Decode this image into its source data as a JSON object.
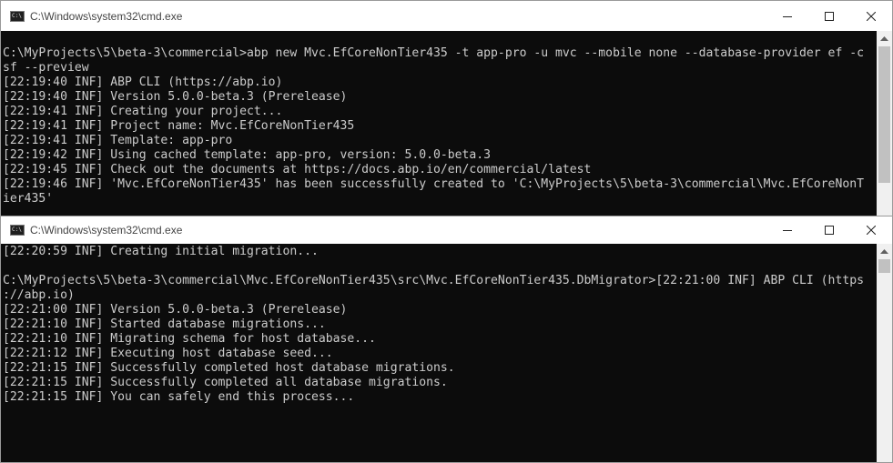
{
  "window_top": {
    "title": "C:\\Windows\\system32\\cmd.exe",
    "lines": [
      "C:\\MyProjects\\5\\beta-3\\commercial>abp new Mvc.EfCoreNonTier435 -t app-pro -u mvc --mobile none --database-provider ef -c",
      "sf --preview",
      "[22:19:40 INF] ABP CLI (https://abp.io)",
      "[22:19:40 INF] Version 5.0.0-beta.3 (Prerelease)",
      "[22:19:41 INF] Creating your project...",
      "[22:19:41 INF] Project name: Mvc.EfCoreNonTier435",
      "[22:19:41 INF] Template: app-pro",
      "[22:19:42 INF] Using cached template: app-pro, version: 5.0.0-beta.3",
      "[22:19:45 INF] Check out the documents at https://docs.abp.io/en/commercial/latest",
      "[22:19:46 INF] 'Mvc.EfCoreNonTier435' has been successfully created to 'C:\\MyProjects\\5\\beta-3\\commercial\\Mvc.EfCoreNonT",
      "ier435'"
    ]
  },
  "window_bottom": {
    "title": "C:\\Windows\\system32\\cmd.exe",
    "lines": [
      "[22:20:59 INF] Creating initial migration...",
      "",
      "C:\\MyProjects\\5\\beta-3\\commercial\\Mvc.EfCoreNonTier435\\src\\Mvc.EfCoreNonTier435.DbMigrator>[22:21:00 INF] ABP CLI (https",
      "://abp.io)",
      "[22:21:00 INF] Version 5.0.0-beta.3 (Prerelease)",
      "[22:21:10 INF] Started database migrations...",
      "[22:21:10 INF] Migrating schema for host database...",
      "[22:21:12 INF] Executing host database seed...",
      "[22:21:15 INF] Successfully completed host database migrations.",
      "[22:21:15 INF] Successfully completed all database migrations.",
      "[22:21:15 INF] You can safely end this process..."
    ]
  },
  "icons": {
    "app": "cmd-app-icon",
    "minimize": "minimize-icon",
    "maximize": "maximize-icon",
    "close": "close-icon",
    "scroll_up": "chevron-up-icon"
  },
  "colors": {
    "console_bg": "#0c0c0c",
    "console_fg": "#cccccc",
    "titlebar_bg": "#ffffff",
    "scrollbar_bg": "#f0f0f0"
  }
}
